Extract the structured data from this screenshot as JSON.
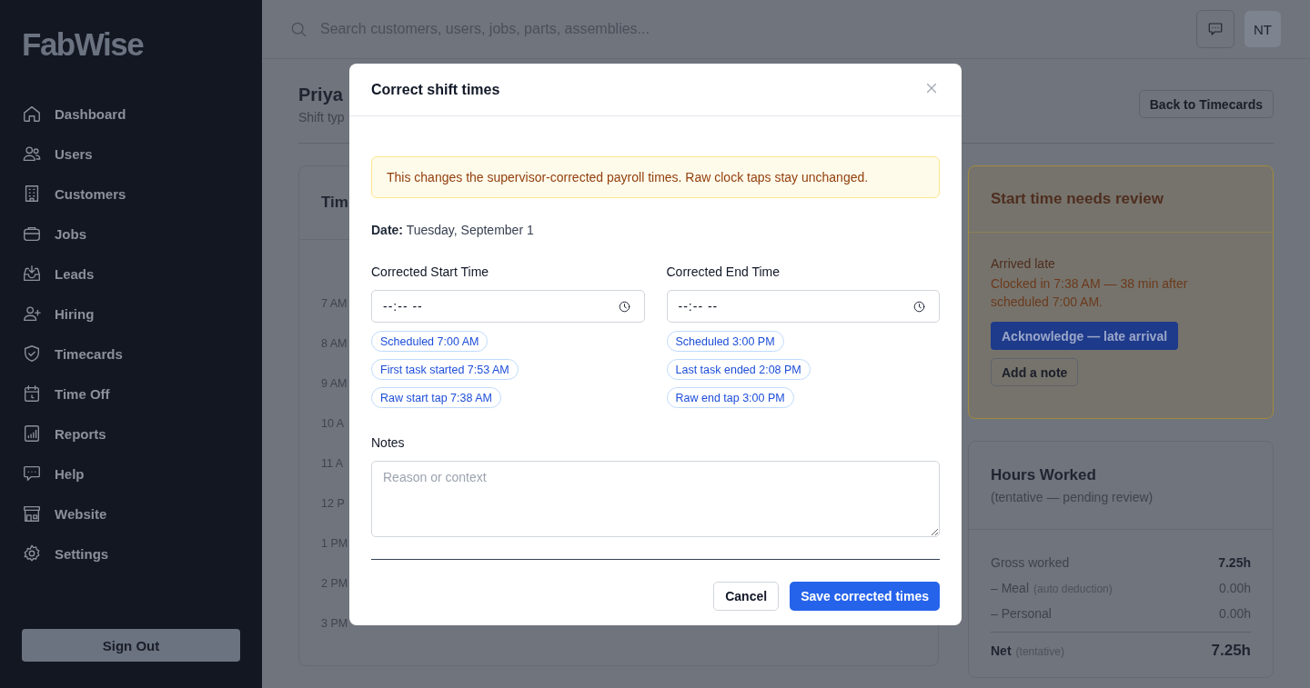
{
  "sidebar": {
    "logo": "FabWise",
    "items": [
      {
        "label": "Dashboard"
      },
      {
        "label": "Users"
      },
      {
        "label": "Customers"
      },
      {
        "label": "Jobs"
      },
      {
        "label": "Leads"
      },
      {
        "label": "Hiring"
      },
      {
        "label": "Timecards"
      },
      {
        "label": "Time Off"
      },
      {
        "label": "Reports"
      },
      {
        "label": "Help"
      },
      {
        "label": "Website"
      },
      {
        "label": "Settings"
      }
    ],
    "sign_out": "Sign Out"
  },
  "top_bar": {
    "search_placeholder": "Search customers, users, jobs, parts, assemblies...",
    "avatar": "NT"
  },
  "page": {
    "title": "Priya",
    "subtitle": "Shift typ",
    "back_button": "Back to Timecards"
  },
  "timeline_card": {
    "title": "Tim",
    "hours": [
      "7 AM",
      "8 AM",
      "9 AM",
      "10 A",
      "11 A",
      "12 P",
      "1 PM",
      "2 PM",
      "3 PM"
    ]
  },
  "review_card": {
    "title": "Start time needs review",
    "heading": "Arrived late",
    "message": "Clocked in 7:38 AM — 38 min after scheduled 7:00 AM.",
    "primary_button": "Acknowledge — late arrival",
    "secondary_button": "Add a note"
  },
  "hours_card": {
    "title": "Hours Worked",
    "subtitle": "(tentative — pending review)",
    "rows": [
      {
        "kind": "gross",
        "label": "Gross worked",
        "value": "7.25h"
      },
      {
        "kind": "deduction",
        "label": "– Meal",
        "note": "(auto deduction)",
        "value": "0.00h"
      },
      {
        "kind": "deduction",
        "label": "– Personal",
        "value": "0.00h"
      },
      {
        "kind": "net",
        "label": "Net",
        "note": "(tentative)",
        "value": "7.25h"
      }
    ]
  },
  "modal": {
    "title": "Correct shift times",
    "alert": "This changes the supervisor-corrected payroll times. Raw clock taps stay unchanged.",
    "date": "**Date:** Tuesday, September 1",
    "fields": [
      {
        "label": "Corrected Start Time",
        "value": "--:-- --",
        "chips": [
          "Scheduled 7:00 AM",
          "First task started 7:53 AM",
          "Raw start tap 7:38 AM"
        ]
      },
      {
        "label": "Corrected End Time",
        "value": "--:-- --",
        "chips": [
          "Scheduled 3:00 PM",
          "Last task ended 2:08 PM",
          "Raw end tap 3:00 PM"
        ]
      }
    ],
    "notes": {
      "label": "Notes",
      "placeholder": "Reason or context"
    },
    "cancel_button": "Cancel",
    "save_button": "Save corrected times"
  }
}
